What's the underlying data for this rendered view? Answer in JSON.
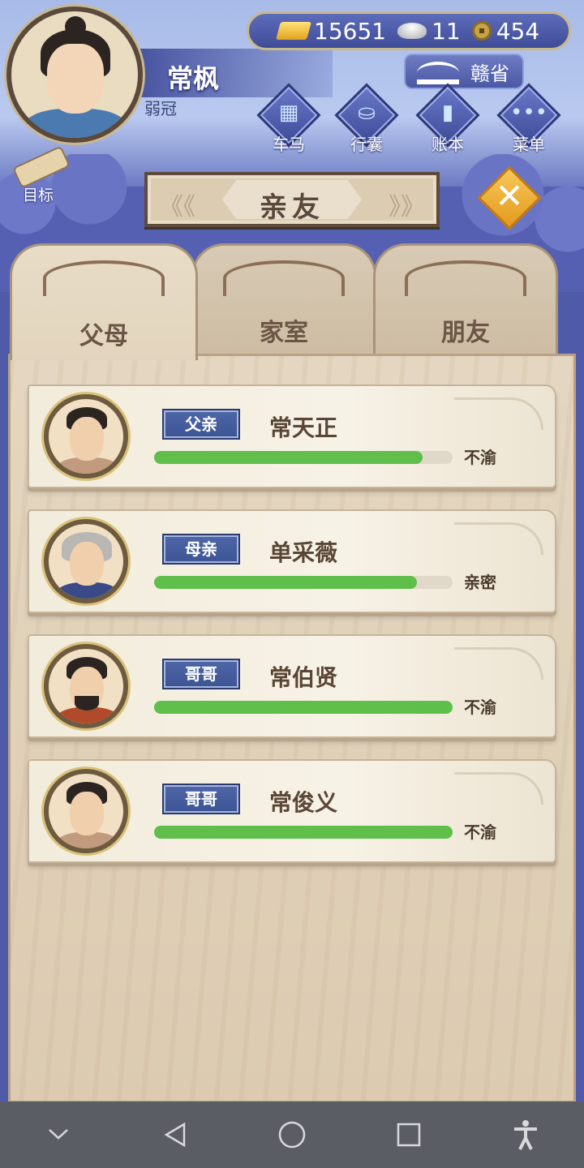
{
  "player": {
    "name": "常枫",
    "rank": "弱冠"
  },
  "currency": {
    "gold": "15651",
    "silver": "11",
    "coins": "454"
  },
  "region": {
    "label": "赣省"
  },
  "menu": {
    "carriage": "车马",
    "bag": "行囊",
    "ledger": "账本",
    "more": "菜单",
    "goal": "目标"
  },
  "title": "亲友",
  "tabs": [
    {
      "label": "父母",
      "active": true
    },
    {
      "label": "家室",
      "active": false
    },
    {
      "label": "朋友",
      "active": false
    }
  ],
  "members": [
    {
      "role": "父亲",
      "name": "常天正",
      "relation": "不渝",
      "affinity": 0.9
    },
    {
      "role": "母亲",
      "name": "单采薇",
      "relation": "亲密",
      "affinity": 0.88
    },
    {
      "role": "哥哥",
      "name": "常伯贤",
      "relation": "不渝",
      "affinity": 1.0
    },
    {
      "role": "哥哥",
      "name": "常俊义",
      "relation": "不渝",
      "affinity": 1.0
    }
  ],
  "colors": {
    "affinity_bar": "#5fbf4a",
    "role_tag": "#3c5493",
    "close_button": "#f0a52a"
  }
}
